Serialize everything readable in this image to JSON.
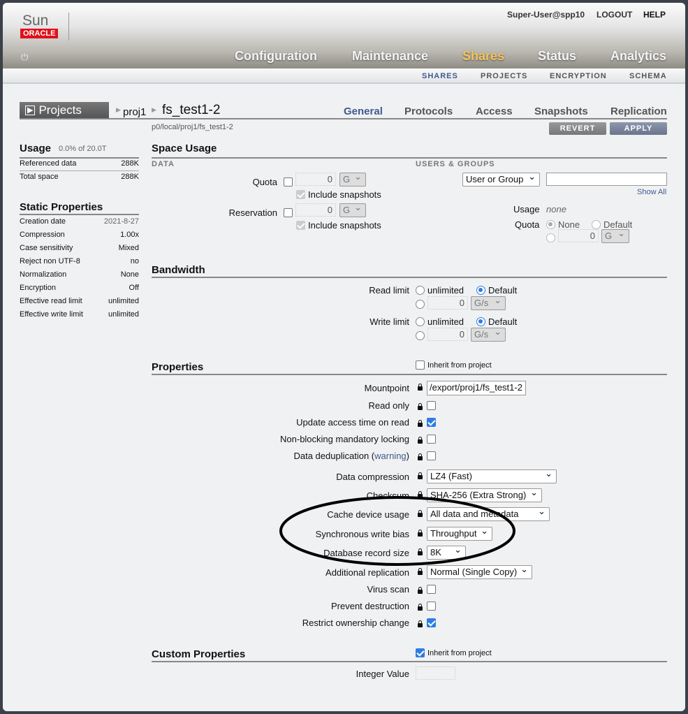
{
  "header": {
    "brand_sun": "Sun",
    "brand_oracle": "ORACLE",
    "user": "Super-User@spp10",
    "logout": "LOGOUT",
    "help": "HELP",
    "main_nav": [
      "Configuration",
      "Maintenance",
      "Shares",
      "Status",
      "Analytics"
    ],
    "active_main": "Shares",
    "sub_nav": [
      "SHARES",
      "PROJECTS",
      "ENCRYPTION",
      "SCHEMA"
    ]
  },
  "breadcrumb": {
    "projects": "Projects",
    "project": "proj1",
    "share": "fs_test1-2",
    "path": "p0/local/proj1/fs_test1-2"
  },
  "tabs": [
    "General",
    "Protocols",
    "Access",
    "Snapshots",
    "Replication"
  ],
  "buttons": {
    "revert": "REVERT",
    "apply": "APPLY"
  },
  "usage": {
    "title": "Usage",
    "summary": "0.0% of 20.0T",
    "rows": [
      {
        "label": "Referenced data",
        "value": "288K"
      },
      {
        "label": "Total space",
        "value": "288K"
      }
    ]
  },
  "static": {
    "title": "Static Properties",
    "rows": [
      {
        "label": "Creation date",
        "value": "2021-8-27"
      },
      {
        "label": "Compression",
        "value": "1.00x"
      },
      {
        "label": "Case sensitivity",
        "value": "Mixed"
      },
      {
        "label": "Reject non UTF-8",
        "value": "no"
      },
      {
        "label": "Normalization",
        "value": "None"
      },
      {
        "label": "Encryption",
        "value": "Off"
      },
      {
        "label": "Effective read limit",
        "value": "unlimited"
      },
      {
        "label": "Effective write limit",
        "value": "unlimited"
      }
    ]
  },
  "space": {
    "title": "Space Usage",
    "data_heading": "DATA",
    "users_heading": "USERS & GROUPS",
    "quota": "Quota",
    "reservation": "Reservation",
    "include_snapshots": "Include snapshots",
    "quota_value": "0",
    "quota_unit": "G",
    "reservation_value": "0",
    "reservation_unit": "G",
    "ug_select": "User or Group",
    "show_all": "Show All",
    "usage_label": "Usage",
    "usage_value": "none",
    "ug_quota": "Quota",
    "none": "None",
    "default": "Default",
    "ug_quota_value": "0",
    "ug_unit": "G"
  },
  "bandwidth": {
    "title": "Bandwidth",
    "read": "Read limit",
    "write": "Write limit",
    "unlimited": "unlimited",
    "default": "Default",
    "value": "0",
    "unit": "G/s"
  },
  "properties": {
    "title": "Properties",
    "inherit": "Inherit from project",
    "mountpoint": "Mountpoint",
    "mountpoint_value": "/export/proj1/fs_test1-2",
    "read_only": "Read only",
    "atime": "Update access time on read",
    "nbmand": "Non-blocking mandatory locking",
    "dedup": "Data deduplication (",
    "dedup_warning": "warning",
    "dedup_close": ")",
    "compression": "Data compression",
    "compression_value": "LZ4 (Fast)",
    "checksum": "Checksum",
    "checksum_value": "SHA-256 (Extra Strong)",
    "cache": "Cache device usage",
    "cache_value": "All data and metadata",
    "sync": "Synchronous write bias",
    "sync_value": "Throughput",
    "recordsize": "Database record size",
    "recordsize_value": "8K",
    "replication": "Additional replication",
    "replication_value": "Normal (Single Copy)",
    "virus": "Virus scan",
    "prevent": "Prevent destruction",
    "restrict": "Restrict ownership change"
  },
  "custom": {
    "title": "Custom Properties",
    "inherit": "Inherit from project",
    "integer": "Integer Value"
  }
}
